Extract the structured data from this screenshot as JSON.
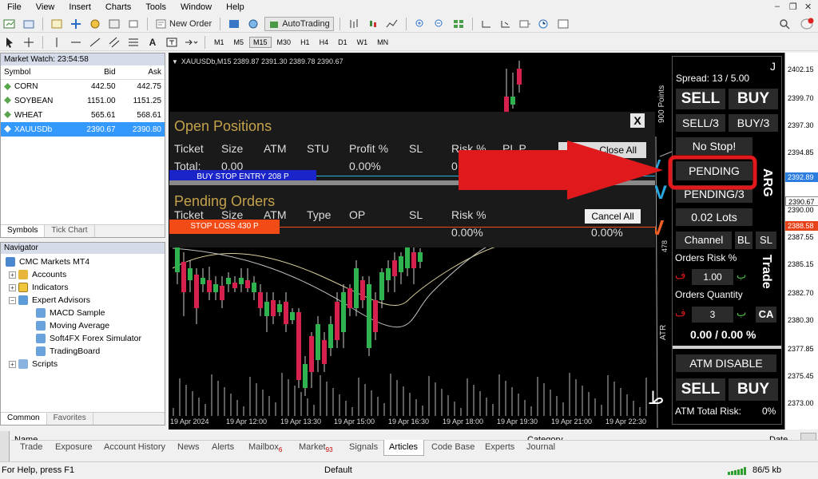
{
  "menu": [
    "File",
    "View",
    "Insert",
    "Charts",
    "Tools",
    "Window",
    "Help"
  ],
  "toolbar": {
    "new_order": "New Order",
    "autotrading": "AutoTrading"
  },
  "timeframes": [
    "M1",
    "M5",
    "M15",
    "M30",
    "H1",
    "H4",
    "D1",
    "W1",
    "MN"
  ],
  "active_timeframe": "M15",
  "market_watch": {
    "title": "Market Watch: 23:54:58",
    "headers": [
      "Symbol",
      "Bid",
      "Ask"
    ],
    "rows": [
      {
        "symbol": "CORN",
        "bid": "442.50",
        "ask": "442.75"
      },
      {
        "symbol": "SOYBEAN",
        "bid": "1151.00",
        "ask": "1151.25"
      },
      {
        "symbol": "WHEAT",
        "bid": "565.61",
        "ask": "568.61"
      },
      {
        "symbol": "XAUUSDb",
        "bid": "2390.67",
        "ask": "2390.80"
      }
    ],
    "tabs": [
      "Symbols",
      "Tick Chart"
    ]
  },
  "navigator": {
    "title": "Navigator",
    "items": [
      "CMC Markets MT4",
      "Accounts",
      "Indicators",
      "Expert Advisors",
      "MACD Sample",
      "Moving Average",
      "Soft4FX Forex Simulator",
      "TradingBoard",
      "Scripts"
    ],
    "tabs": [
      "Common",
      "Favorites"
    ]
  },
  "chart": {
    "header": "XAUUSDb,M15  2389.87 2391.30 2389.78 2390.67",
    "price_ticks": [
      "2402.15",
      "2399.70",
      "2397.30",
      "2394.85",
      "2392.40",
      "2390.00",
      "2387.55",
      "2385.15",
      "2382.70",
      "2380.30",
      "2377.85",
      "2375.45",
      "2373.00"
    ],
    "price_tags": {
      "blue": "2392.89",
      "white": "2390.67",
      "red": "2388.58"
    },
    "time_ticks": [
      "19 Apr 2024",
      "19 Apr 12:00",
      "19 Apr 13:30",
      "19 Apr 15:00",
      "19 Apr 16:30",
      "19 Apr 18:00",
      "19 Apr 19:30",
      "19 Apr 21:00",
      "19 Apr 22:30"
    ],
    "side_labels": {
      "points": "900 Points",
      "atr": "ATR",
      "num": "478"
    }
  },
  "overlay": {
    "close": "X",
    "open_positions": "Open Positions",
    "op_headers": [
      "Ticket",
      "Size",
      "ATM",
      "STU",
      "Profit %",
      "SL",
      "Risk %",
      "PL P"
    ],
    "op_total": "Total:",
    "op_size": "0.00",
    "op_profit": "0.00%",
    "op_risk": "0",
    "close_all": "Close All",
    "buy_stop_line": "BUY STOP ENTRY 208 P",
    "pending_orders": "Pending Orders",
    "po_headers": [
      "Ticket",
      "Size",
      "ATM",
      "Type",
      "OP",
      "SL",
      "Risk %"
    ],
    "cancel_all": "Cancel All",
    "stop_loss_line": "STOP LOSS 430 P",
    "po_risk": "0.00%",
    "po_pl": "0.00%"
  },
  "panel": {
    "corner": "J",
    "spread": "Spread: 13 / 5.00",
    "sell": "SELL",
    "buy": "BUY",
    "sell3": "SELL/3",
    "buy3": "BUY/3",
    "no_stop": "No Stop!",
    "pending": "PENDING",
    "pending3": "PENDING/3",
    "lots": "0.02 Lots",
    "channel": "Channel",
    "bl": "BL",
    "sl": "SL",
    "arg": "ARG",
    "trade": "Trade",
    "orders_risk": "Orders Risk %",
    "risk_val": "1.00",
    "orders_qty": "Orders Quantity",
    "qty_val": "3",
    "ca": "CA",
    "summary": "0.00 / 0.00 %",
    "atm_disable": "ATM DISABLE",
    "sell2": "SELL",
    "buy2": "BUY",
    "atm_total": "ATM Total Risk:",
    "atm_total_val": "0%"
  },
  "terminal": {
    "headers": {
      "name": "Name",
      "category": "Category",
      "date": "Date"
    },
    "tabs": [
      {
        "label": "Trade"
      },
      {
        "label": "Exposure"
      },
      {
        "label": "Account History"
      },
      {
        "label": "News"
      },
      {
        "label": "Alerts"
      },
      {
        "label": "Mailbox",
        "badge": "6"
      },
      {
        "label": "Market",
        "badge": "93"
      },
      {
        "label": "Signals"
      },
      {
        "label": "Articles"
      },
      {
        "label": "Code Base"
      },
      {
        "label": "Experts"
      },
      {
        "label": "Journal"
      }
    ],
    "active_tab": "Articles"
  },
  "status": {
    "help": "For Help, press F1",
    "profile": "Default",
    "traffic": "86/5 kb"
  },
  "colors": {
    "accent_red": "#e0191d",
    "pending_blue": "#1a24c8",
    "stop_orange": "#f24b16",
    "panel_bg": "#000000"
  }
}
